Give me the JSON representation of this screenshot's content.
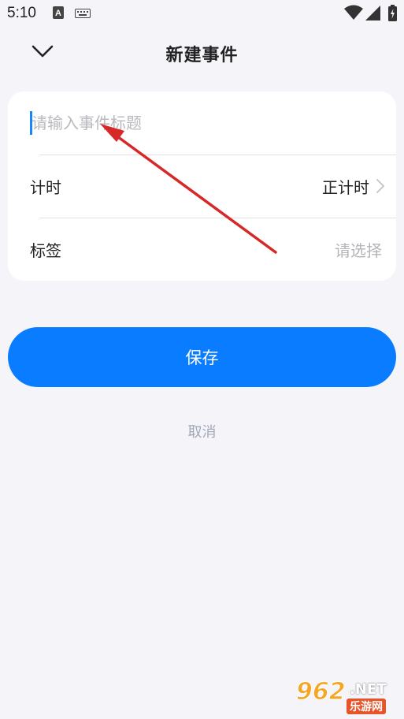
{
  "status_bar": {
    "time": "5:10",
    "icons": [
      "font-a-icon",
      "keyboard-icon",
      "wifi-icon",
      "signal-icon",
      "battery-charging-icon"
    ]
  },
  "header": {
    "back_icon": "chevron-down-icon",
    "title": "新建事件"
  },
  "form": {
    "title_placeholder": "请输入事件标题",
    "title_value": "",
    "timer": {
      "label": "计时",
      "value": "正计时"
    },
    "tag": {
      "label": "标签",
      "placeholder": "请选择"
    }
  },
  "actions": {
    "save_label": "保存",
    "cancel_label": "取消"
  },
  "colors": {
    "accent": "#0a7cff",
    "background": "#f4f4f9",
    "annotation_arrow": "#d62828"
  },
  "watermark": {
    "number": "962",
    "suffix": ".NET",
    "site": "乐游网"
  }
}
